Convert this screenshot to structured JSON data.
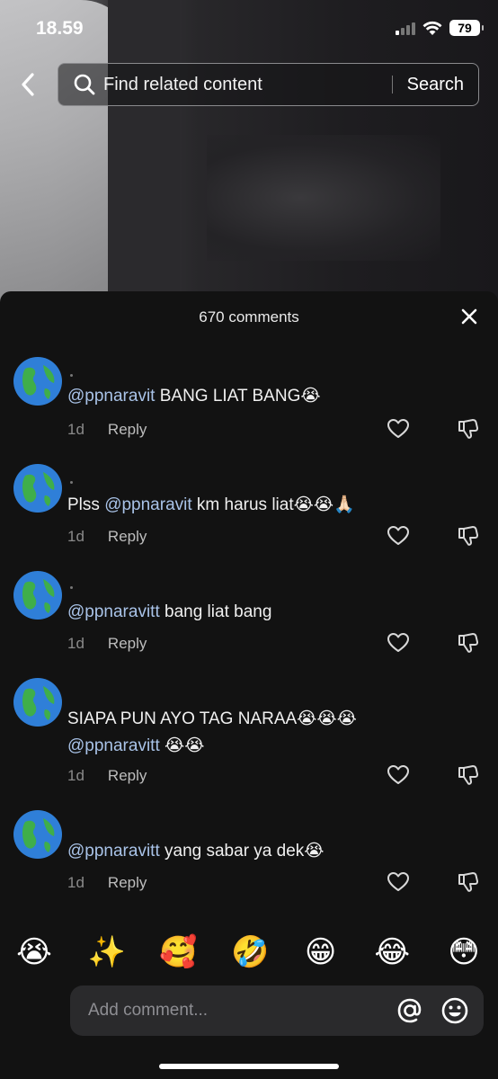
{
  "status": {
    "time": "18.59",
    "battery": "79"
  },
  "top": {
    "search_placeholder": "Find related content",
    "search_button": "Search"
  },
  "comments_header": {
    "count_label": "670 comments"
  },
  "comments": [
    {
      "pre": "",
      "mention": "@ppnaravit",
      "post": " BANG LIAT BANG😭",
      "time": "1d",
      "reply": "Reply"
    },
    {
      "pre": "Plss ",
      "mention": "@ppnaravit",
      "post": " km harus liat😭😭🙏🏻",
      "time": "1d",
      "reply": "Reply"
    },
    {
      "pre": "",
      "mention": "@ppnaravitt",
      "post": " bang liat bang",
      "time": "1d",
      "reply": "Reply"
    },
    {
      "pre": "SIAPA PUN AYO TAG NARAA😭😭😭",
      "mention": "@ppnaravitt",
      "post": " 😭😭",
      "time": "1d",
      "reply": "Reply"
    },
    {
      "pre": "",
      "mention": "@ppnaravitt",
      "post": " yang sabar ya dek😭",
      "time": "1d",
      "reply": "Reply"
    }
  ],
  "emoji_bar": [
    "😭",
    "✨",
    "🥰",
    "🤣",
    "😁",
    "😂",
    "😳"
  ],
  "input": {
    "placeholder": "Add comment..."
  },
  "avatar_emoji": "🌏"
}
